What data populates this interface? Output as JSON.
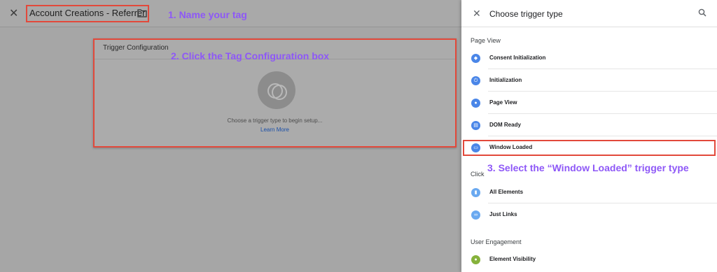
{
  "editor": {
    "tag_name": "Account Creations - Referrer",
    "card_title": "Trigger Configuration",
    "card_hint": "Choose a trigger type to begin setup...",
    "card_link": "Learn More"
  },
  "annotations": {
    "step1": "1. Name your tag",
    "step2": "2. Click the Tag Configuration box",
    "step3": "3. Select the “Window Loaded” trigger type"
  },
  "panel": {
    "title": "Choose trigger type",
    "sections": [
      {
        "heading": "Page View",
        "items": [
          {
            "label": "Consent Initialization",
            "icon": "shield-icon"
          },
          {
            "label": "Initialization",
            "icon": "power-icon"
          },
          {
            "label": "Page View",
            "icon": "eye-icon"
          },
          {
            "label": "DOM Ready",
            "icon": "document-icon"
          },
          {
            "label": "Window Loaded",
            "icon": "window-icon"
          }
        ]
      },
      {
        "heading": "Click",
        "items": [
          {
            "label": "All Elements",
            "icon": "mouse-icon"
          },
          {
            "label": "Just Links",
            "icon": "link-icon"
          }
        ]
      },
      {
        "heading": "User Engagement",
        "items": [
          {
            "label": "Element Visibility",
            "icon": "eye-icon"
          }
        ]
      }
    ]
  },
  "colors": {
    "accent": "#4a86e8",
    "highlight": "#e2493b",
    "annotation": "#8e58f7",
    "green_icon": "#86b23b"
  }
}
